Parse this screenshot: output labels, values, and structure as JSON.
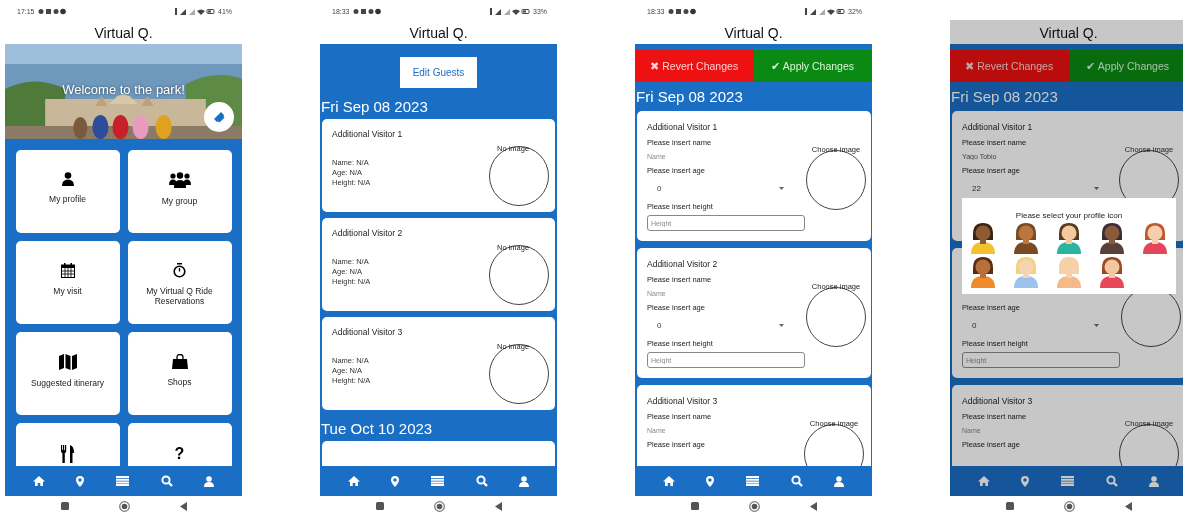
{
  "phones": [
    {
      "kind": "home",
      "status_bar": {
        "time": "17:15",
        "battery": "41%"
      },
      "title": "Virtual Q.",
      "banner": {
        "kind": "picture",
        "text": "Welcome to the park!"
      },
      "tiles": [
        {
          "kind": "labeled",
          "label": "My profile"
        },
        {
          "kind": "labeled",
          "label": "My group"
        },
        {
          "kind": "labeled",
          "label": "My visit"
        },
        {
          "kind": "labeled",
          "label": "My Virtual Q Ride Reservations"
        },
        {
          "kind": "labeled",
          "label": "Suggested itinerary"
        },
        {
          "kind": "labeled",
          "label": "Shops"
        },
        {
          "kind": "icon_only"
        },
        {
          "kind": "glyph",
          "glyph": "?"
        }
      ]
    },
    {
      "kind": "guests",
      "status_bar": {
        "time": "18:33",
        "battery": "33%"
      },
      "title": "Virtual Q.",
      "edit_button": "Edit Guests",
      "sections": [
        {
          "date": "Fri Sep 08 2023",
          "visitors": [
            {
              "title": "Additional Visitor 1",
              "lines": [
                "Name: N/A",
                "Age: N/A",
                "Height: N/A"
              ],
              "image_label": "No image"
            },
            {
              "title": "Additional Visitor 2",
              "lines": [
                "Name: N/A",
                "Age: N/A",
                "Height: N/A"
              ],
              "image_label": "No image"
            },
            {
              "title": "Additional Visitor 3",
              "lines": [
                "Name: N/A",
                "Age: N/A",
                "Height: N/A"
              ],
              "image_label": "No image"
            }
          ]
        },
        {
          "date": "Tue Oct 10 2023"
        }
      ]
    },
    {
      "kind": "edit",
      "status_bar": {
        "time": "18:33",
        "battery": "32%"
      },
      "title": "Virtual Q.",
      "revert_button": "✖ Revert Changes",
      "apply_button": "✔ Apply Changes",
      "date": "Fri Sep 08 2023",
      "visitors": [
        {
          "title": "Additional Visitor 1",
          "name_label": "Please insert name",
          "name_placeholder": "Name",
          "age_label": "Please insert age",
          "age_value": "0",
          "height_label": "Please insert height",
          "height_placeholder": "Height",
          "image_label": "Choose image"
        },
        {
          "title": "Additional Visitor 2",
          "name_label": "Please insert name",
          "name_placeholder": "Name",
          "age_label": "Please insert age",
          "age_value": "0",
          "height_label": "Please insert height",
          "height_placeholder": "Height",
          "image_label": "Choose image"
        },
        {
          "title": "Additional Visitor 3",
          "name_label": "Please insert name",
          "name_placeholder": "Name",
          "age_label": "Please insert age",
          "image_label": "Choose image"
        }
      ]
    },
    {
      "kind": "edit",
      "title": "Virtual Q.",
      "revert_button": "✖ Revert Changes",
      "apply_button": "✔ Apply Changes",
      "date": "Fri Sep 08 2023",
      "visitors": [
        {
          "title": "Additional Visitor 1",
          "name_label": "Please insert name",
          "name_value": "Yago Tobio",
          "age_label": "Please insert age",
          "age_value": "22",
          "image_label": "Choose image"
        },
        {
          "age_label": "Please insert age",
          "age_value": "0",
          "height_label": "Please insert height",
          "height_placeholder": "Height"
        },
        {
          "title": "Additional Visitor 3",
          "name_label": "Please insert name",
          "name_placeholder": "Name",
          "age_label": "Please insert age",
          "image_label": "Choose image"
        }
      ],
      "modal": {
        "title": "Please select your profile icon"
      }
    }
  ]
}
